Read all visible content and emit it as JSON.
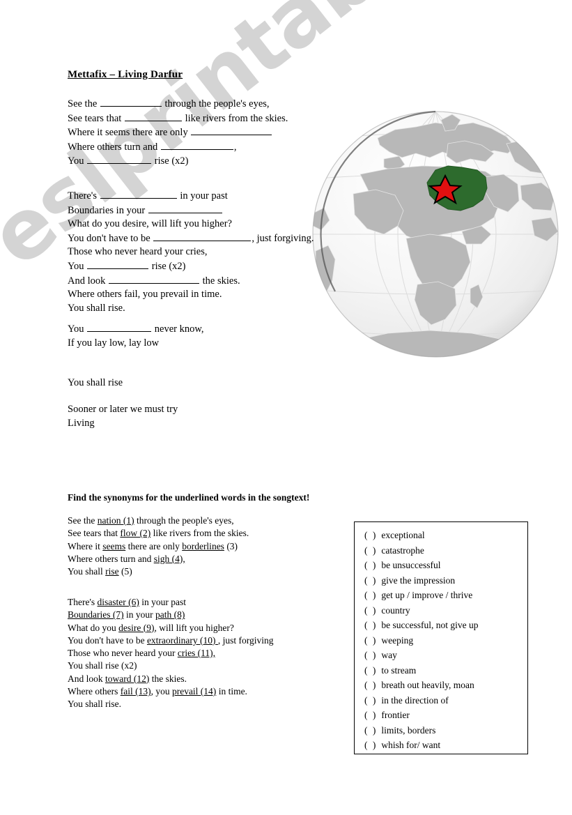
{
  "document": {
    "title": "Mettafix – Living Darfur",
    "watermark": "eslprintables.com"
  },
  "song": {
    "verse1": [
      {
        "pre": "See the ",
        "blank": 88,
        "post": " through the people's eyes,"
      },
      {
        "pre": "See tears that ",
        "blank": 82,
        "post": " like rivers from the skies."
      },
      {
        "pre": "Where it seems there are only ",
        "blank": 116,
        "post": ""
      },
      {
        "pre": "Where others turn and ",
        "blank": 104,
        "post": ","
      },
      {
        "pre": "You ",
        "blank": 92,
        "post": " rise (x2)"
      }
    ],
    "verse2": [
      {
        "pre": "There's ",
        "blank": 110,
        "post": " in your past"
      },
      {
        "pre": "Boundaries in your ",
        "blank": 106,
        "post": ""
      },
      {
        "pre": "What do you desire, will lift you higher?",
        "blank": 0,
        "post": ""
      },
      {
        "pre": "You don't have to be ",
        "blank": 140,
        "post": ", just forgiving."
      },
      {
        "pre": "Those who never heard your cries,",
        "blank": 0,
        "post": ""
      },
      {
        "pre": "You ",
        "blank": 88,
        "post": " rise  (x2)"
      },
      {
        "pre": "And look ",
        "blank": 130,
        "post": " the skies."
      },
      {
        "pre": "Where others fail, you prevail in time.",
        "blank": 0,
        "post": ""
      },
      {
        "pre": "You shall rise.",
        "blank": 0,
        "post": ""
      }
    ],
    "verse3": [
      {
        "pre": "You ",
        "blank": 92,
        "post": " never know,"
      },
      {
        "pre": "If you lay low, lay low",
        "blank": 0,
        "post": ""
      }
    ],
    "verse4": [
      {
        "pre": "You shall rise",
        "blank": 0,
        "post": ""
      }
    ],
    "verse5": [
      {
        "pre": "Sooner or later we must try",
        "blank": 0,
        "post": ""
      },
      {
        "pre": "Living",
        "blank": 0,
        "post": ""
      }
    ]
  },
  "exercise": {
    "instruction": "Find the synonyms for the underlined words in the songtext!",
    "stanza1": [
      [
        {
          "t": "See the "
        },
        {
          "t": "nation (1)",
          "u": true
        },
        {
          "t": " through the people's eyes,"
        }
      ],
      [
        {
          "t": "See tears that "
        },
        {
          "t": "flow (2)",
          "u": true
        },
        {
          "t": " like rivers from the skies."
        }
      ],
      [
        {
          "t": "Where it "
        },
        {
          "t": "seems",
          "u": true
        },
        {
          "t": " there are only "
        },
        {
          "t": "borderlines",
          "u": true
        },
        {
          "t": " (3)"
        }
      ],
      [
        {
          "t": "Where others turn and "
        },
        {
          "t": "sigh (4),",
          "u": true
        }
      ],
      [
        {
          "t": "You shall "
        },
        {
          "t": "rise",
          "u": true
        },
        {
          "t": " (5)"
        }
      ]
    ],
    "stanza2": [
      [
        {
          "t": "There's "
        },
        {
          "t": "disaster (6)",
          "u": true
        },
        {
          "t": " in your past"
        }
      ],
      [
        {
          "t": "Boundaries (7)",
          "u": true
        },
        {
          "t": " in your "
        },
        {
          "t": "path (8)",
          "u": true
        }
      ],
      [
        {
          "t": "What do you "
        },
        {
          "t": "desire (9)",
          "u": true
        },
        {
          "t": ", will lift you higher?"
        }
      ],
      [
        {
          "t": "You don't have to be "
        },
        {
          "t": "extraordinary (10) ",
          "u": true
        },
        {
          "t": ", just forgiving"
        }
      ],
      [
        {
          "t": "Those who never heard your "
        },
        {
          "t": "cries (11),",
          "u": true
        }
      ],
      [
        {
          "t": "You shall rise (x2)"
        }
      ],
      [
        {
          "t": "And look "
        },
        {
          "t": "toward (12)",
          "u": true
        },
        {
          "t": " the skies."
        }
      ],
      [
        {
          "t": "Where others "
        },
        {
          "t": "fail (13)",
          "u": true
        },
        {
          "t": ", you "
        },
        {
          "t": "prevail (14)",
          "u": true
        },
        {
          "t": " in time."
        }
      ],
      [
        {
          "t": "You shall rise."
        }
      ]
    ],
    "answer_options": [
      "exceptional",
      "catastrophe",
      "be unsuccessful",
      "give the impression",
      "get up / improve / thrive",
      "country",
      "be successful, not give up",
      "weeping",
      "way",
      "to stream",
      "breath out heavily, moan",
      "in the direction of",
      "frontier",
      "limits, borders",
      "whish for/ want"
    ],
    "answer_marker": "(  )"
  },
  "illustration": {
    "name": "globe-africa-sudan",
    "highlight_country": "Sudan",
    "highlight_color": "#2d6b2d",
    "marker": "red-star",
    "marker_color": "#e01010",
    "sphere_color": "#f2f2f2",
    "land_color": "#b4b4b4"
  }
}
